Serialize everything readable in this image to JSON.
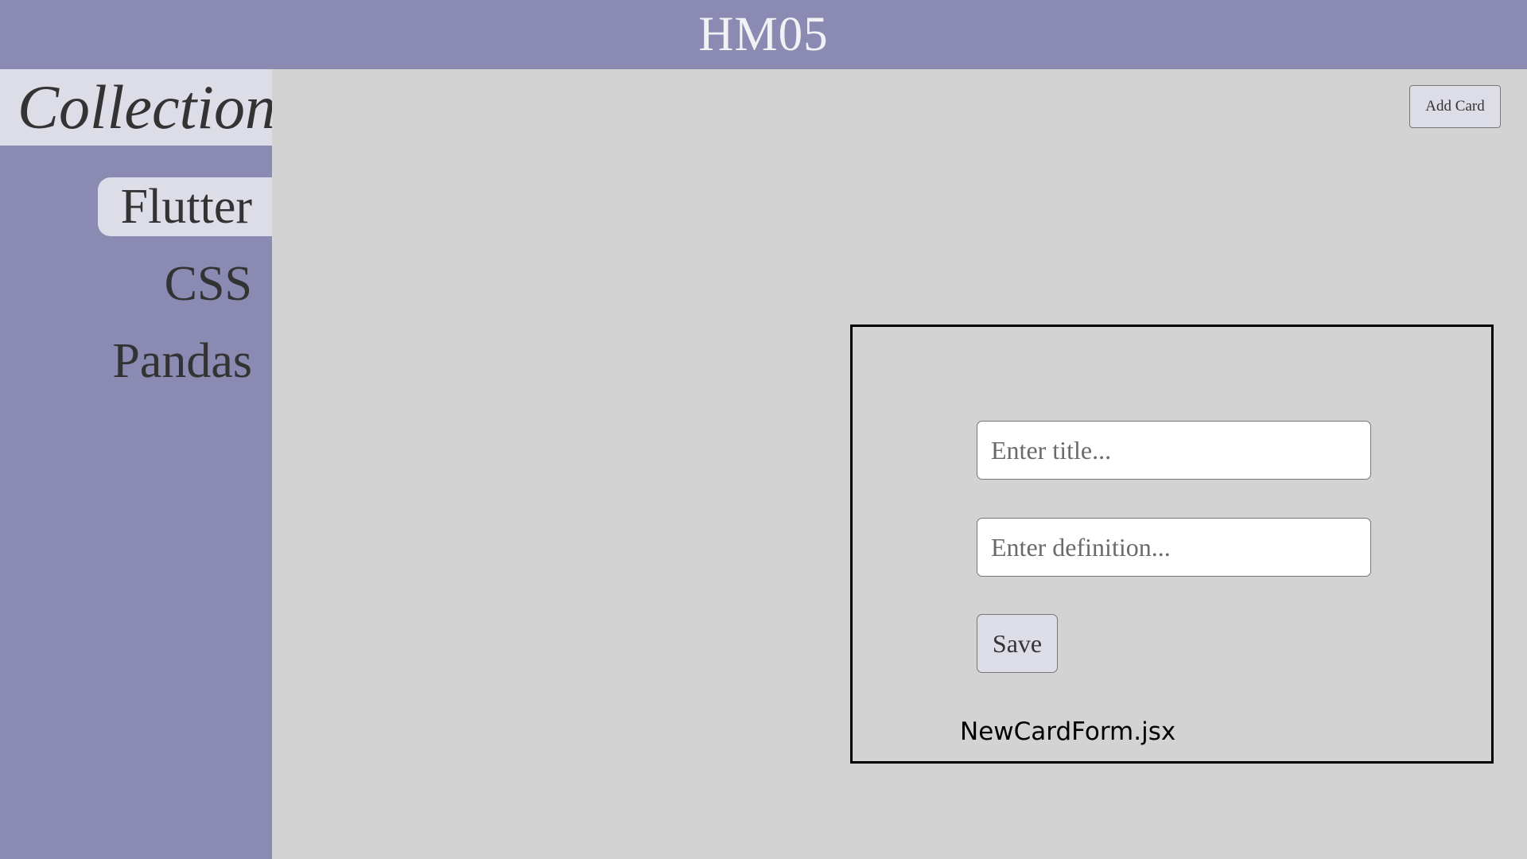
{
  "header": {
    "title": "HM05"
  },
  "sidebar": {
    "title": "Collections",
    "items": [
      {
        "label": "Flutter",
        "active": true
      },
      {
        "label": "CSS",
        "active": false
      },
      {
        "label": "Pandas",
        "active": false
      }
    ]
  },
  "toolbar": {
    "add_card_label": "Add Card"
  },
  "form": {
    "title_placeholder": "Enter title...",
    "title_value": "",
    "definition_placeholder": "Enter definition...",
    "definition_value": "",
    "save_label": "Save",
    "file_label": "NewCardForm.jsx"
  },
  "colors": {
    "accent": "#8a8ab3",
    "highlight": "#dddde8",
    "background": "#d3d3d3"
  }
}
